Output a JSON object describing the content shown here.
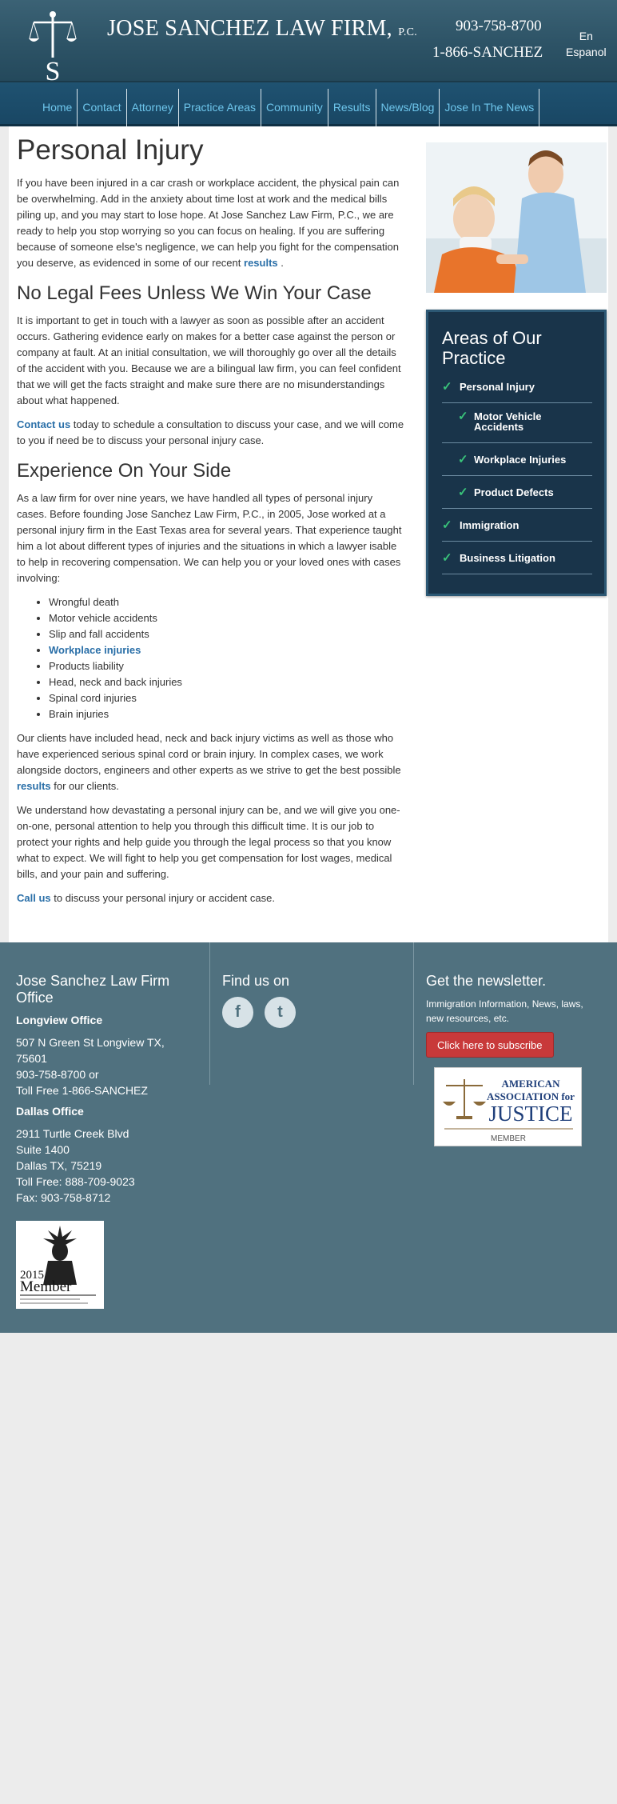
{
  "header": {
    "firm_name": "JOSE SANCHEZ LAW FIRM,",
    "firm_suffix": "P.C.",
    "phone_main": "903-758-8700",
    "phone_alt": "1-866-SANCHEZ",
    "lang_en": "En",
    "lang_es": "Espanol"
  },
  "nav": {
    "items": [
      "Home",
      "Contact",
      "Attorney",
      "Practice Areas",
      "Community",
      "Results",
      "News/Blog",
      "Jose In The News"
    ]
  },
  "content": {
    "title": "Personal Injury",
    "intro": "If you have been injured in a car crash or workplace accident, the physical pain can be overwhelming. Add in the anxiety about time lost at work and the medical bills piling up, and you may start to lose hope. At Jose Sanchez Law Firm, P.C., we are ready to help you stop worrying so you can focus on healing. If you are suffering because of someone else's negligence, we can help you fight for the compensation you deserve, as evidenced in some of our recent",
    "intro_link": "results",
    "intro_end": " .",
    "h2_fees": "No Legal Fees Unless We Win Your Case",
    "fees_p": "It is important to get in touch with a lawyer as soon as possible after an accident occurs. Gathering evidence early on makes for a better case against the person or company at fault. At an initial consultation, we will thoroughly go over all the details of the accident with you. Because we are a bilingual law firm, you can feel confident that we will get the facts straight and make sure there are no misunderstandings about what happened.",
    "contact_link": "Contact us",
    "contact_rest": " today to schedule a consultation to discuss your case, and we will come to you if need be to discuss your personal injury case.",
    "h2_exp": "Experience On Your Side",
    "exp_p": "As a law firm for over nine years, we have handled all types of personal injury cases. Before founding Jose Sanchez Law Firm, P.C., in 2005, Jose worked at a personal injury firm in the East Texas area for several years. That experience taught him a lot about different types of injuries and the situations in which a lawyer isable to help in recovering compensation. We can help you or your loved ones with cases involving:",
    "list": [
      "Wrongful death",
      "Motor vehicle accidents",
      "Slip and fall accidents",
      "Workplace injuries",
      "Products liability",
      "Head, neck and back injuries",
      "Spinal cord injuries",
      "Brain injuries"
    ],
    "clients_p": "Our clients have included head, neck and back injury victims as well as those who have experienced serious spinal cord or brain injury. In complex cases, we work alongside doctors, engineers and other experts as we strive to get the best possible",
    "clients_link": "results",
    "clients_end": " for our clients.",
    "understand_p": "We understand how devastating a personal injury can be, and we will give you one-on-one, personal attention to help you through this difficult time. It is our job to protect your rights and help guide you through the legal process so that you know what to expect. We will fight to help you get compensation for lost wages, medical bills, and your pain and suffering.",
    "call_link": "Call us",
    "call_rest": " to discuss your personal injury or accident case."
  },
  "practice": {
    "title": "Areas of Our Practice",
    "items": [
      {
        "label": "Personal Injury",
        "sub": false
      },
      {
        "label": "Motor Vehicle Accidents",
        "sub": true
      },
      {
        "label": "Workplace Injuries",
        "sub": true
      },
      {
        "label": "Product Defects",
        "sub": true
      },
      {
        "label": "Immigration",
        "sub": false
      },
      {
        "label": "Business Litigation",
        "sub": false
      }
    ]
  },
  "footer": {
    "office_title": "Jose Sanchez Law Firm Office",
    "longview_heading": "Longview Office",
    "longview_addr1": "507 N Green St Longview TX,",
    "longview_addr2": "75601",
    "longview_phone": "903-758-8700 or",
    "longview_toll": "Toll Free 1-866-SANCHEZ",
    "dallas_heading": "Dallas Office",
    "dallas_addr1": "2911 Turtle Creek Blvd",
    "dallas_addr2": "Suite 1400",
    "dallas_addr3": "Dallas TX, 75219",
    "dallas_toll": "Toll Free: 888-709-9023",
    "dallas_fax": "Fax: 903-758-8712",
    "find_us": "Find us on",
    "facebook": "f",
    "twitter": "t",
    "newsletter_title": "Get the newsletter.",
    "newsletter_desc": "Immigration Information, News, laws, new resources, etc.",
    "subscribe_label": "Click here to subscribe",
    "aaj_line1": "AMERICAN",
    "aaj_line2": "ASSOCIATION for",
    "aaj_line3": "JUSTICE",
    "aaj_member": "MEMBER",
    "badge_year": "2015",
    "badge_member": "Member"
  },
  "colors": {
    "header_bg": "#2d5366",
    "nav_bg": "#1f5271",
    "nav_link": "#6ec6ec",
    "link": "#2a6fa8",
    "practice_bg": "#19344a",
    "check": "#39c37a",
    "footer_bg": "#50717f",
    "subscribe_bg": "#c8393a"
  },
  "icons": [
    "scales-logo-icon",
    "check-icon",
    "facebook-icon",
    "twitter-icon"
  ]
}
